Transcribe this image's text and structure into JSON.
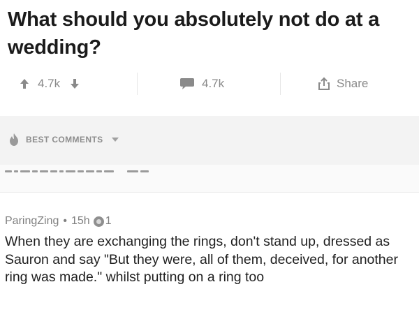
{
  "post": {
    "title": "What should you absolutely not do at a wedding?"
  },
  "actions": {
    "upvotes": "4.7k",
    "comments": "4.7k",
    "share_label": "Share"
  },
  "sort": {
    "label": "BEST COMMENTS"
  },
  "comment": {
    "author": "ParingZing",
    "separator": "•",
    "age": "15h",
    "award_count": "1",
    "body": "When they are exchanging the rings, don't stand up, dressed as Sauron and say \"But they were, all of them, deceived, for another ring was made.\" whilst putting on a ring too"
  },
  "colors": {
    "text": "#1f1f1f",
    "muted": "#8a8a8a",
    "sort_bar_bg": "#f3f3f3"
  },
  "icons": {
    "upvote": "arrow-up-icon",
    "downvote": "arrow-down-icon",
    "comments": "speech-bubble-icon",
    "share": "share-icon",
    "sort": "flame-icon",
    "caret": "caret-down-icon",
    "award": "award-icon"
  }
}
